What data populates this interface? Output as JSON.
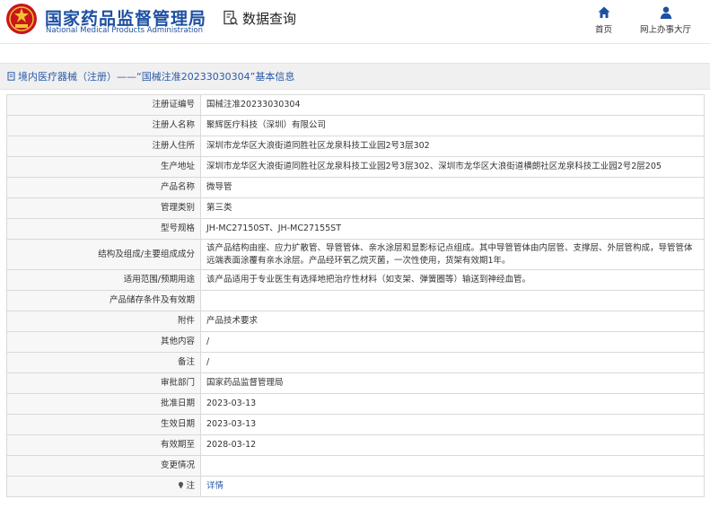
{
  "header": {
    "org_cn": "国家药品监督管理局",
    "org_en": "National Medical Products Administration",
    "query_label": "数据查询",
    "nav_home": "首页",
    "nav_hall": "网上办事大厅"
  },
  "breadcrumb": {
    "text": "境内医疗器械（注册）——“国械注准20233030304”基本信息"
  },
  "rows": [
    {
      "label": "注册证编号",
      "value": "国械注准20233030304"
    },
    {
      "label": "注册人名称",
      "value": "聚辉医疗科技（深圳）有限公司"
    },
    {
      "label": "注册人住所",
      "value": "深圳市龙华区大浪街道同胜社区龙泉科技工业园2号3层302"
    },
    {
      "label": "生产地址",
      "value": "深圳市龙华区大浪街道同胜社区龙泉科技工业园2号3层302、深圳市龙华区大浪街道横朗社区龙泉科技工业园2号2层205"
    },
    {
      "label": "产品名称",
      "value": "微导管"
    },
    {
      "label": "管理类别",
      "value": "第三类"
    },
    {
      "label": "型号规格",
      "value": "JH-MC27150ST、JH-MC27155ST"
    },
    {
      "label": "结构及组成/主要组成成分",
      "value": "该产品结构由座、应力扩散管、导管管体、亲水涂层和显影标记点组成。其中导管管体由内层管、支撑层、外层管构成，导管管体远端表面涂覆有亲水涂层。产品经环氧乙烷灭菌，一次性使用，货架有效期1年。"
    },
    {
      "label": "适用范围/预期用途",
      "value": "该产品适用于专业医生有选择地把治疗性材料（如支架、弹簧圈等）输送到神经血管。"
    },
    {
      "label": "产品储存条件及有效期",
      "value": ""
    },
    {
      "label": "附件",
      "value": "产品技术要求"
    },
    {
      "label": "其他内容",
      "value": "/"
    },
    {
      "label": "备注",
      "value": "/"
    },
    {
      "label": "审批部门",
      "value": "国家药品监督管理局"
    },
    {
      "label": "批准日期",
      "value": "2023-03-13"
    },
    {
      "label": "生效日期",
      "value": "2023-03-13"
    },
    {
      "label": "有效期至",
      "value": "2028-03-12"
    },
    {
      "label": "变更情况",
      "value": ""
    },
    {
      "label": "注",
      "value": "详情"
    }
  ],
  "colors": {
    "brand_blue": "#1e50a2",
    "logo_red": "#c8161d",
    "link_blue": "#2a5aa8"
  }
}
